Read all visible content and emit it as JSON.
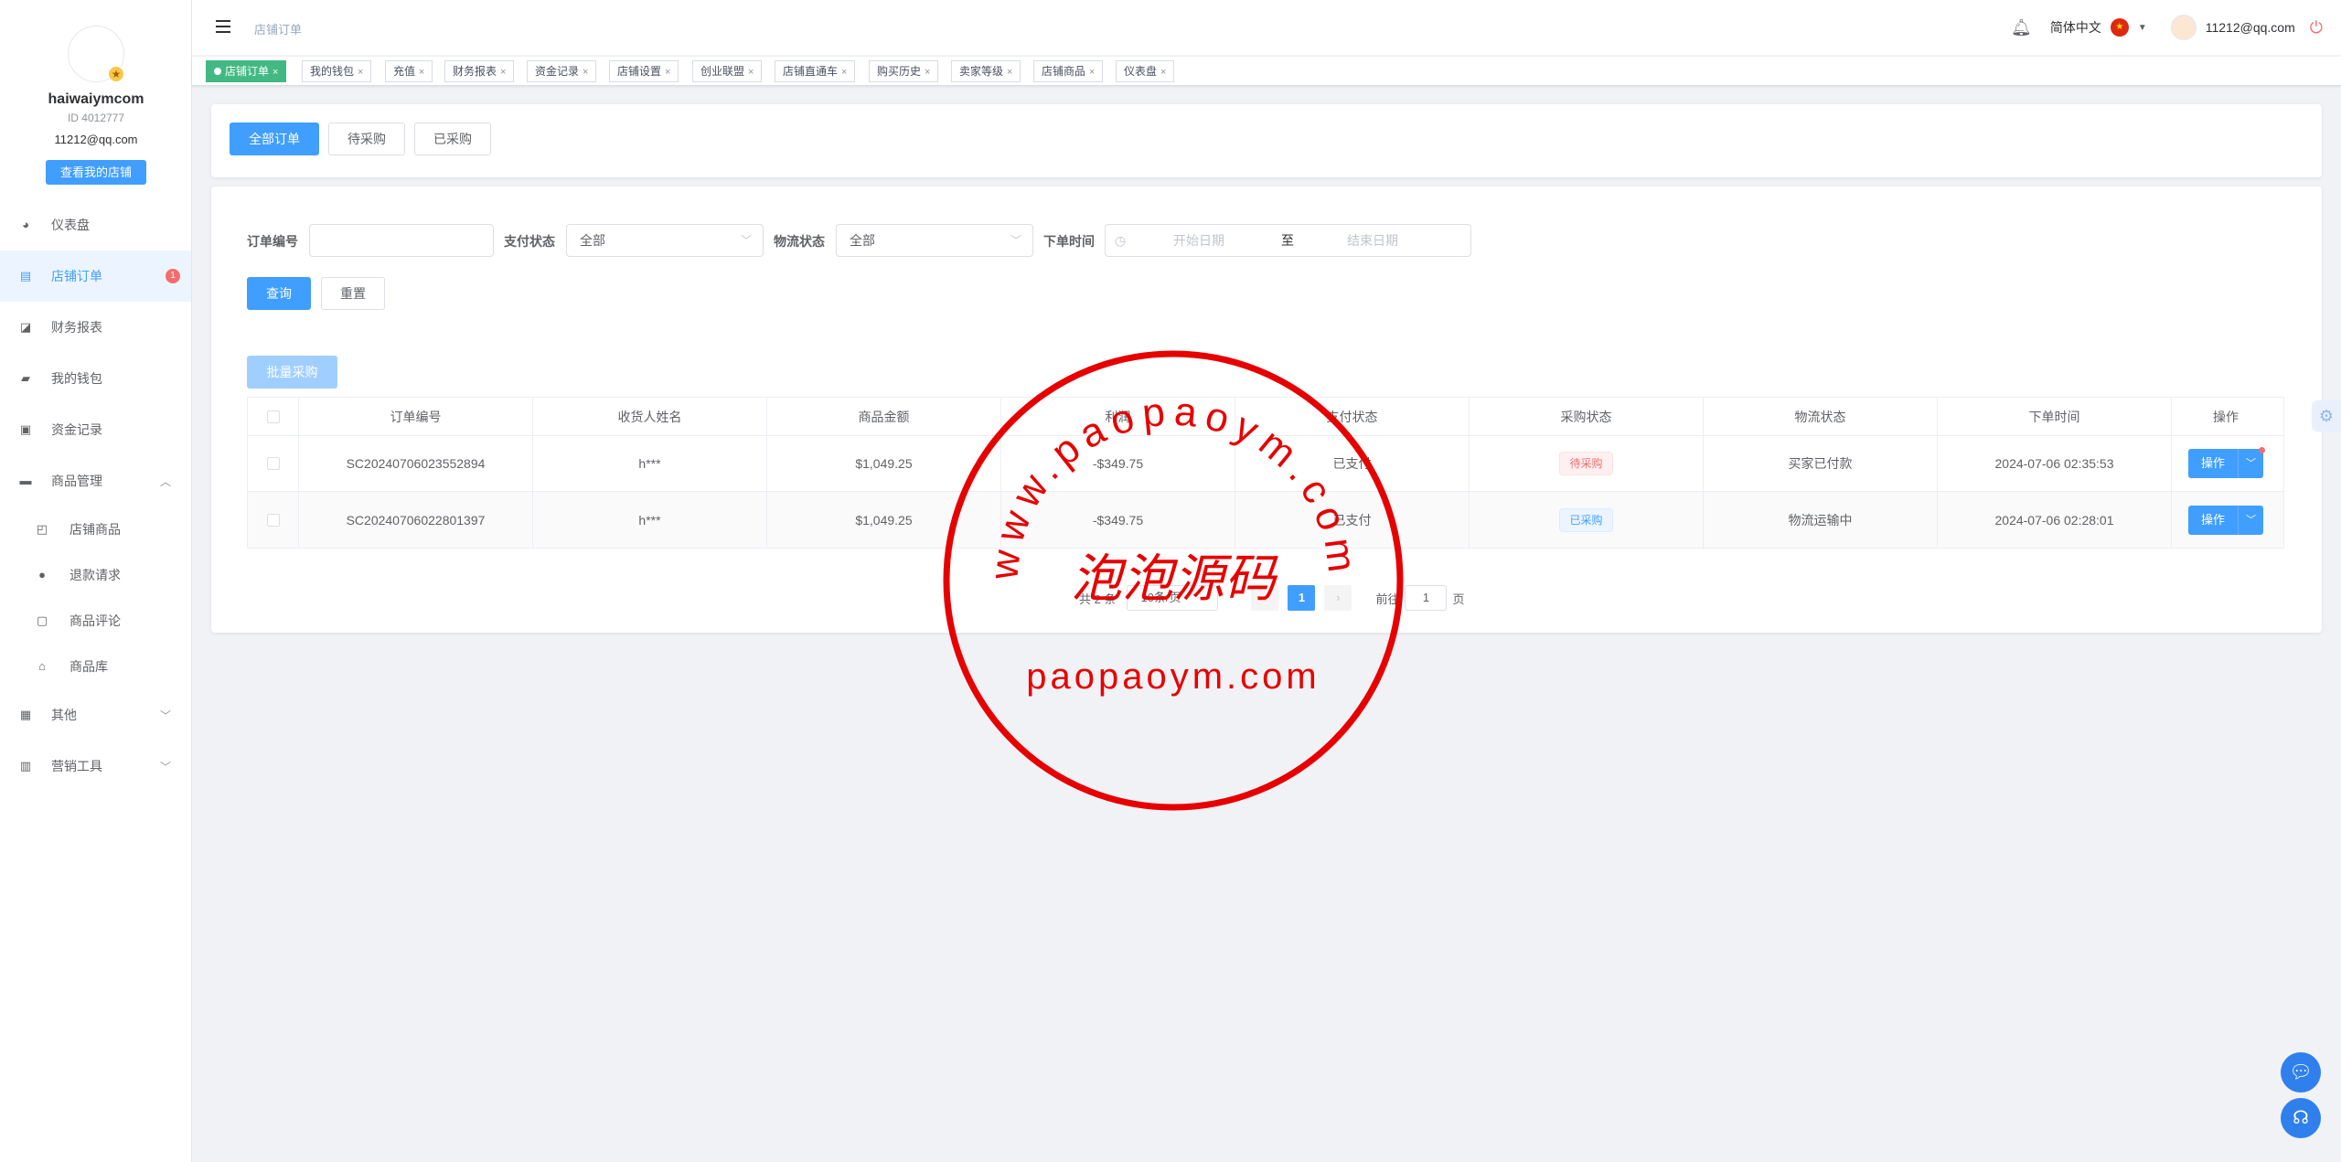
{
  "profile": {
    "username": "haiwaiymcom",
    "id_text": "ID 4012777",
    "email": "11212@qq.com",
    "shop_button": "查看我的店铺"
  },
  "sidebar": {
    "items": [
      {
        "label": "仪表盘",
        "icon": "dashboard-icon"
      },
      {
        "label": "店铺订单",
        "icon": "clipboard-icon",
        "active": true,
        "count": "1"
      },
      {
        "label": "财务报表",
        "icon": "chart-line-icon"
      },
      {
        "label": "我的钱包",
        "icon": "wallet-icon"
      },
      {
        "label": "资金记录",
        "icon": "document-icon"
      },
      {
        "label": "商品管理",
        "icon": "briefcase-icon",
        "expanded": true
      }
    ],
    "sub_items": [
      {
        "label": "店铺商品",
        "icon": "bag-icon"
      },
      {
        "label": "退款请求",
        "icon": "alert-circle-icon"
      },
      {
        "label": "商品评论",
        "icon": "comment-icon"
      },
      {
        "label": "商品库",
        "icon": "home-icon"
      }
    ],
    "bottom_items": [
      {
        "label": "其他",
        "icon": "grid-icon"
      },
      {
        "label": "营销工具",
        "icon": "bar-chart-icon"
      }
    ]
  },
  "header": {
    "breadcrumb": "店铺订单",
    "language": "简体中文",
    "user_email": "11212@qq.com"
  },
  "tags": [
    {
      "label": "店铺订单",
      "active": true
    },
    {
      "label": "我的钱包"
    },
    {
      "label": "充值"
    },
    {
      "label": "财务报表"
    },
    {
      "label": "资金记录"
    },
    {
      "label": "店铺设置"
    },
    {
      "label": "创业联盟"
    },
    {
      "label": "店铺直通车"
    },
    {
      "label": "购买历史"
    },
    {
      "label": "卖家等级"
    },
    {
      "label": "店铺商品"
    },
    {
      "label": "仪表盘"
    }
  ],
  "order_tabs": [
    "全部订单",
    "待采购",
    "已采购"
  ],
  "filters": {
    "order_no_label": "订单编号",
    "order_no_value": "",
    "pay_status_label": "支付状态",
    "pay_status_value": "全部",
    "logistics_label": "物流状态",
    "logistics_value": "全部",
    "time_label": "下单时间",
    "start_placeholder": "开始日期",
    "range_sep": "至",
    "end_placeholder": "结束日期",
    "query_button": "查询",
    "reset_button": "重置"
  },
  "batch_button": "批量采购",
  "table": {
    "columns": [
      "订单编号",
      "收货人姓名",
      "商品金额",
      "利润",
      "支付状态",
      "采购状态",
      "物流状态",
      "下单时间",
      "操作"
    ],
    "rows": [
      {
        "order_no": "SC20240706023552894",
        "name": "h***",
        "amount": "$1,049.25",
        "profit": "-$349.75",
        "pay": "已支付",
        "purchase": "待采购",
        "purchase_color": "red",
        "logistics": "买家已付款",
        "time": "2024-07-06 02:35:53",
        "op": "操作"
      },
      {
        "order_no": "SC20240706022801397",
        "name": "h***",
        "amount": "$1,049.25",
        "profit": "-$349.75",
        "pay": "已支付",
        "purchase": "已采购",
        "purchase_color": "blue",
        "logistics": "物流运输中",
        "time": "2024-07-06 02:28:01",
        "op": "操作"
      }
    ]
  },
  "pagination": {
    "total": "共 2 条",
    "page_size": "10条/页",
    "current": "1",
    "goto_label": "前往",
    "goto_value": "1",
    "page_unit": "页"
  },
  "watermark": {
    "top_text": "www.paopaoym.com",
    "middle_text": "泡泡源码",
    "bottom_text": "paopaoym.com",
    "color": "#e60000"
  }
}
